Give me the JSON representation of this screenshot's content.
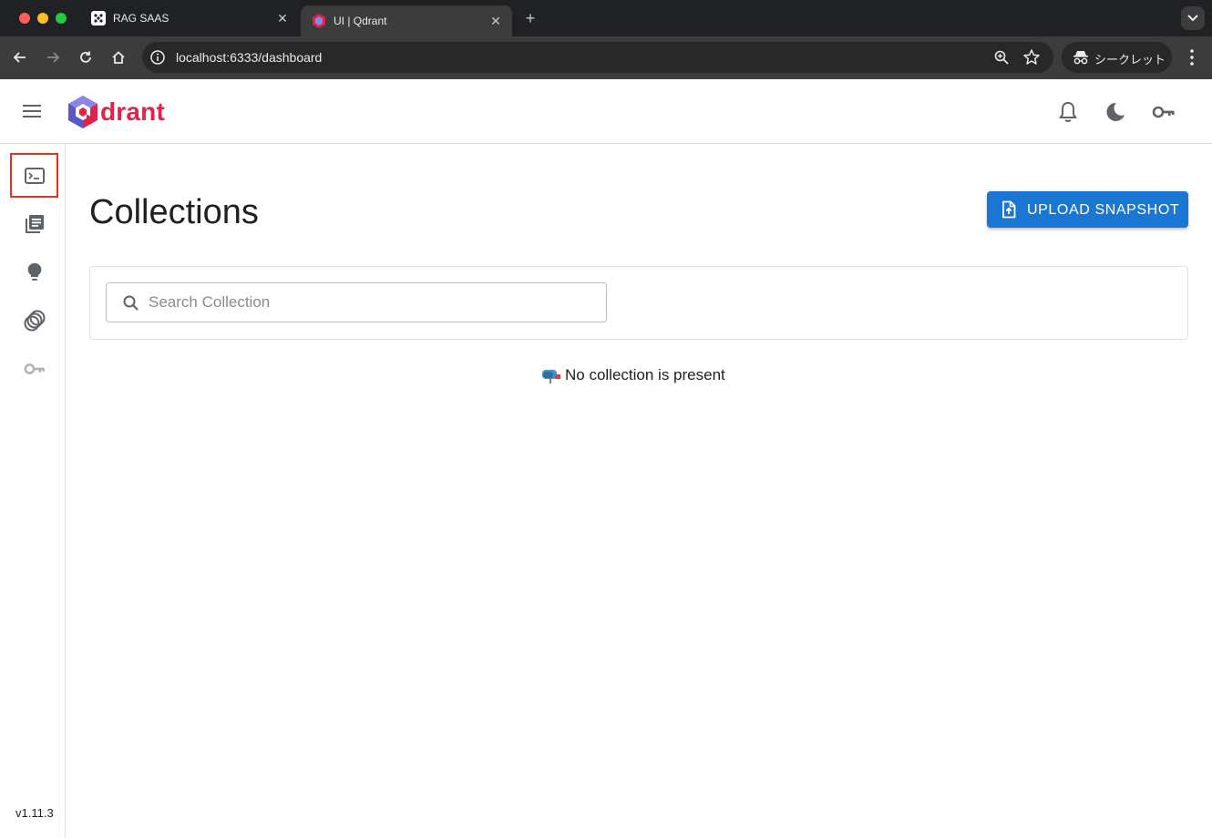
{
  "browser": {
    "tabs": [
      {
        "title": "RAG SAAS",
        "active": false
      },
      {
        "title": "UI | Qdrant",
        "active": true
      }
    ],
    "url": "localhost:6333/dashboard",
    "incognito_label": "シークレット"
  },
  "header": {
    "logo_text": "drant",
    "brand_color": "#dc244c"
  },
  "sidebar": {
    "items": [
      {
        "name": "console",
        "icon": "terminal-icon"
      },
      {
        "name": "collections",
        "icon": "library-books-icon"
      },
      {
        "name": "tutorial",
        "icon": "lightbulb-icon"
      },
      {
        "name": "datasets",
        "icon": "rings-icon"
      },
      {
        "name": "access-tokens",
        "icon": "key-icon"
      }
    ],
    "version": "v1.11.3"
  },
  "main": {
    "title": "Collections",
    "upload_button": "UPLOAD SNAPSHOT",
    "search_placeholder": "Search Collection",
    "search_value": "",
    "empty_message": "No collection is present"
  },
  "colors": {
    "primary": "#1976d2",
    "highlight_box": "#e3321e"
  }
}
